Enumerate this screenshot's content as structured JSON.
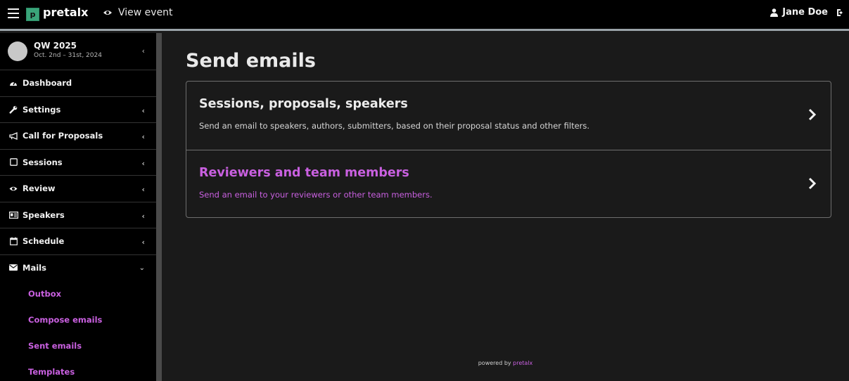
{
  "topbar": {
    "logo_letter": "p",
    "brand": "pretalx",
    "view_event": "View event",
    "user_name": "Jane Doe"
  },
  "event": {
    "name": "QW 2025",
    "dates": "Oct. 2nd – 31st, 2024"
  },
  "sidebar": {
    "items": [
      {
        "label": "Dashboard",
        "icon": "dashboard-icon"
      },
      {
        "label": "Settings",
        "icon": "wrench-icon"
      },
      {
        "label": "Call for Proposals",
        "icon": "bullhorn-icon"
      },
      {
        "label": "Sessions",
        "icon": "sticky-note-icon"
      },
      {
        "label": "Review",
        "icon": "eye-icon"
      },
      {
        "label": "Speakers",
        "icon": "id-card-icon"
      },
      {
        "label": "Schedule",
        "icon": "calendar-icon"
      },
      {
        "label": "Mails",
        "icon": "envelope-icon"
      }
    ],
    "mail_subitems": [
      "Outbox",
      "Compose emails",
      "Sent emails",
      "Templates"
    ]
  },
  "main": {
    "title": "Send emails",
    "rows": [
      {
        "title": "Sessions, proposals, speakers",
        "description": "Send an email to speakers, authors, submitters, based on their proposal status and other filters."
      },
      {
        "title": "Reviewers and team members",
        "description": "Send an email to your reviewers or other team members."
      }
    ]
  },
  "footer": {
    "prefix": "powered by",
    "link": "pretalx"
  },
  "colors": {
    "accent": "#c960e0",
    "logo_green": "#3aa57a",
    "background": "#1a1a1a",
    "sidebar": "#000000"
  }
}
